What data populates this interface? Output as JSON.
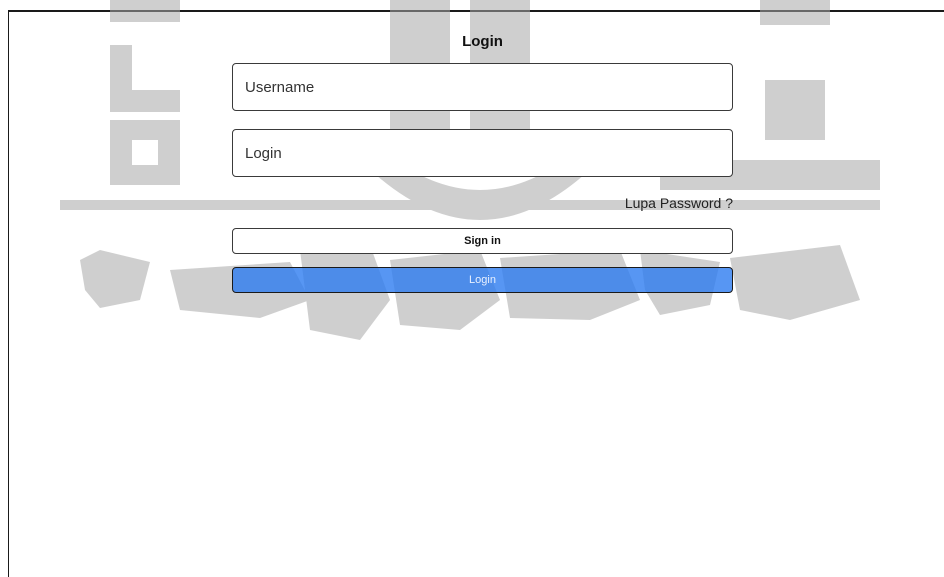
{
  "form": {
    "title": "Login",
    "username_placeholder": "Username",
    "password_placeholder": "Login",
    "forgot_password_label": "Lupa Password ?",
    "signin_label": "Sign in",
    "login_label": "Login"
  },
  "colors": {
    "login_button": "#2878f0",
    "watermark": "#c8c8c8"
  }
}
